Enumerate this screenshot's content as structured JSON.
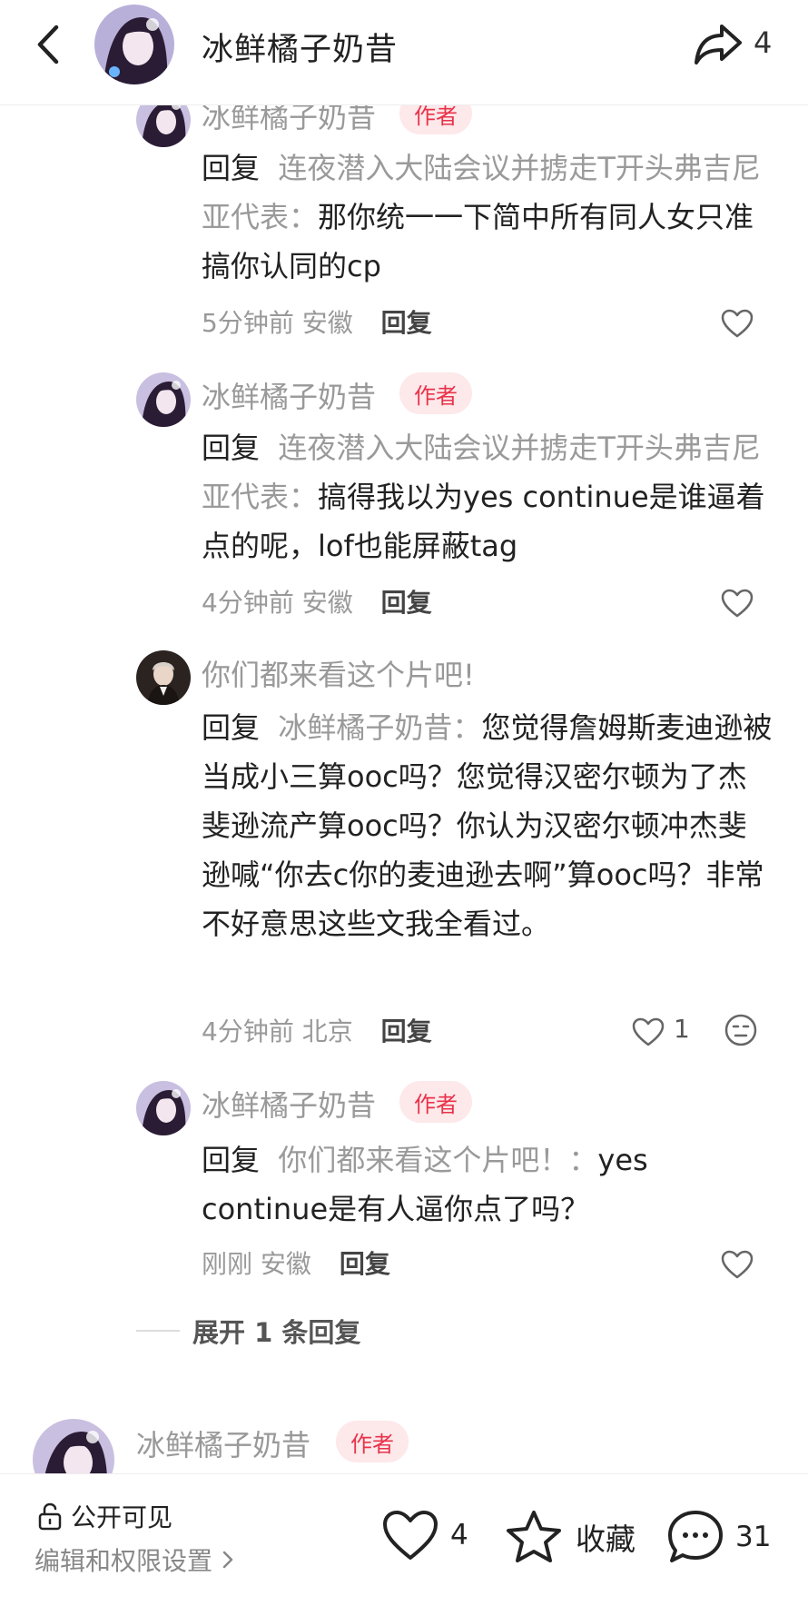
{
  "header": {
    "title": "冰鲜橘子奶昔",
    "share_count": "4"
  },
  "comments": [
    {
      "name": "冰鲜橘子奶昔",
      "badge": "作者",
      "reply_prefix": "回复",
      "reply_to": "连夜潜入大陆会议并掳走T开头弗吉尼亚代表：",
      "text": "那你统一一下简中所有同人女只准搞你认同的cp",
      "time": "5分钟前",
      "location": "安徽",
      "reply_label": "回复"
    },
    {
      "name": "冰鲜橘子奶昔",
      "badge": "作者",
      "reply_prefix": "回复",
      "reply_to": "连夜潜入大陆会议并掳走T开头弗吉尼亚代表：",
      "text": "搞得我以为yes continue是谁逼着点的呢，lof也能屏蔽tag",
      "time": "4分钟前",
      "location": "安徽",
      "reply_label": "回复"
    },
    {
      "name": "你们都来看这个片吧!",
      "reply_prefix": "回复",
      "reply_to": "冰鲜橘子奶昔：",
      "text": "您觉得詹姆斯麦迪逊被当成小三算ooc吗？您觉得汉密尔顿为了杰斐逊流产算ooc吗？你认为汉密尔顿冲杰斐逊喊“你去c你的麦迪逊去啊”算ooc吗？非常不好意思这些文我全看过。",
      "time": "4分钟前",
      "location": "北京",
      "reply_label": "回复",
      "like_count": "1"
    },
    {
      "name": "冰鲜橘子奶昔",
      "badge": "作者",
      "reply_prefix": "回复",
      "reply_to": "你们都来看这个片吧！：",
      "text": "yes continue是有人逼你点了吗？",
      "time": "刚刚",
      "location": "安徽",
      "reply_label": "回复"
    }
  ],
  "expand_label": "展开 1 条回复",
  "next_comment": {
    "name": "冰鲜橘子奶昔",
    "badge": "作者"
  },
  "bottom_bar": {
    "visibility_label": "公开可见",
    "permissions_label": "编辑和权限设置",
    "like_count": "4",
    "collect_label": "收藏",
    "comment_count": "31"
  },
  "colors": {
    "badge_bg": "#fde8ea",
    "badge_text": "#e8334a",
    "muted_text": "#999999"
  }
}
